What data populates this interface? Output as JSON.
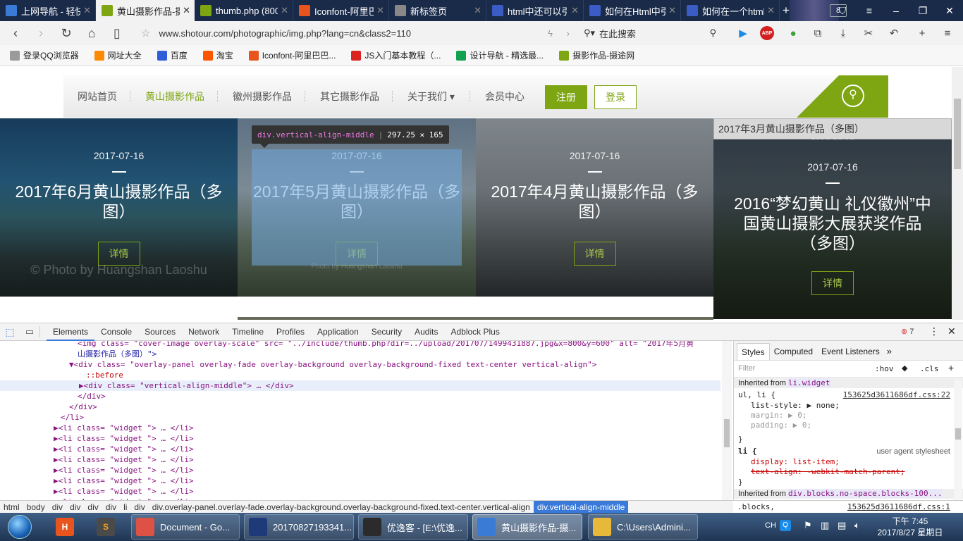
{
  "browser": {
    "tabs": [
      {
        "title": "上网导航 - 轻快上",
        "icon_color": "#3a7bd5",
        "icon": "e-icon"
      },
      {
        "title": "黄山摄影作品-摄",
        "icon_color": "#7ea512",
        "icon": "leaf-icon",
        "active": true
      },
      {
        "title": "thumb.php (800",
        "icon_color": "#7ea512",
        "icon": "leaf-icon"
      },
      {
        "title": "Iconfont-阿里巴巴",
        "icon_color": "#e8541e",
        "icon": "iconfont-icon"
      },
      {
        "title": "新标签页",
        "icon_color": "#888888",
        "icon": "grid-icon"
      },
      {
        "title": "html中还可以引h",
        "icon_color": "#3b5cc4",
        "icon": "csdn-icon"
      },
      {
        "title": "如何在Html中引入",
        "icon_color": "#3b5cc4",
        "icon": "csdn-icon"
      },
      {
        "title": "如何在一个html",
        "icon_color": "#3b5cc4",
        "icon": "csdn-icon"
      }
    ],
    "tab_count": "8",
    "url": "www.shotour.com/photographic/img.php?lang=cn&class2=110",
    "search_placeholder": "在此搜索",
    "bookmarks": [
      {
        "label": "登录QQ浏览器",
        "color": "#9a9a9a"
      },
      {
        "label": "网址大全",
        "color": "#ff8a00"
      },
      {
        "label": "百度",
        "color": "#2f5fd8"
      },
      {
        "label": "淘宝",
        "color": "#ff5500"
      },
      {
        "label": "Iconfont-阿里巴巴...",
        "color": "#e8541e"
      },
      {
        "label": "JS入门基本教程（...",
        "color": "#d8231f"
      },
      {
        "label": "设计导航 - 精选最...",
        "color": "#12a150"
      },
      {
        "label": "摄影作品-摄途网",
        "color": "#7ea512"
      }
    ]
  },
  "site": {
    "nav": [
      "网站首页",
      "黄山摄影作品",
      "徽州摄影作品",
      "其它摄影作品",
      "关于我们",
      "会员中心"
    ],
    "nav_active_index": 1,
    "register": "注册",
    "login": "登录",
    "accent": "#7ea512",
    "cards": [
      {
        "date": "2017-07-16",
        "title": "2017年6月黄山摄影作品（多图）",
        "button": "详情",
        "watermark": "© Photo by Huangshan Laoshu"
      },
      {
        "date": "2017-07-16",
        "title": "2017年5月黄山摄影作品（多图）",
        "button": "详情",
        "watermark": "Photo by Huangshan Laoshu"
      },
      {
        "date": "2017-07-16",
        "title": "2017年4月黄山摄影作品（多图）",
        "button": "详情"
      },
      {
        "date": "2017-07-16",
        "title": "2016“梦幻黄山 礼仪徽州”中国黄山摄影大展获奖作品（多图）",
        "button": "详情",
        "alt_text": "2017年3月黄山摄影作品（多图）",
        "hidden_date": "2017-07-16"
      }
    ]
  },
  "inspector_tooltip": {
    "selector": "div.vertical-align-middle",
    "size": "297.25 × 165"
  },
  "devtools": {
    "tabs": [
      "Elements",
      "Console",
      "Sources",
      "Network",
      "Timeline",
      "Profiles",
      "Application",
      "Security",
      "Audits",
      "Adblock Plus"
    ],
    "error_count": "7",
    "dom_lines": [
      "<img class= \"cover-image overlay-scale\" src= \"../include/thumb.php?dir=../upload/201707/1499431887.jpg&x=800&y=600\" alt= \"2017年5月黄",
      "山摄影作品（多图）\">",
      "▼<div class= \"overlay-panel overlay-fade overlay-background overlay-background-fixed text-center vertical-align\">",
      "::before",
      "▶<div class= \"vertical-align-middle\"> … </div>",
      "</div>",
      "</div>",
      "</li>",
      "▶<li class= \"widget \"> … </li>",
      "▶<li class= \"widget \"> … </li>",
      "▶<li class= \"widget \"> … </li>",
      "▶<li class= \"widget \"> … </li>",
      "▶<li class= \"widget \"> … </li>",
      "▶<li class= \"widget \"> … </li>",
      "▶<li class= \"widget \"> … </li>",
      "▶<li class= \"widget \"> … </li>"
    ],
    "styles_tabs": [
      "Styles",
      "Computed",
      "Event Listeners"
    ],
    "filter_placeholder": "Filter",
    "hov": ":hov",
    "cls": ".cls",
    "inherited_from_1": "Inherited from",
    "inherited_sel_1": "li.widget",
    "rule1_selector": "ul, li {",
    "rule1_source": "153625d3611686df.css:22",
    "rule1_props": [
      "list-style: ▶ none;",
      "margin: ▶ 0;",
      "padding: ▶ 0;"
    ],
    "rule2_selector": "li {",
    "rule2_source": "user agent stylesheet",
    "rule2_props": [
      "display: list-item;",
      "text-align: -webkit-match-parent;"
    ],
    "inherited_from_2": "Inherited from",
    "inherited_sel_2": "div.blocks.no-space.blocks-100...",
    "rule3_selector": ".blocks,",
    "rule3_source": "153625d3611686df.css:1",
    "crumbs": [
      "html",
      "body",
      "div",
      "div",
      "div",
      "div",
      "li",
      "div",
      "div.overlay-panel.overlay-fade.overlay-background.overlay-background-fixed.text-center.vertical-align",
      "div.vertical-align-middle"
    ]
  },
  "taskbar": {
    "items": [
      {
        "label": "Document - Go...",
        "icon_color": "#de5246",
        "icon": "chrome-icon"
      },
      {
        "label": "20170827193341...",
        "icon_color": "#1f3a78",
        "icon": "photoshop-icon"
      },
      {
        "label": "优逸客 - [E:\\优逸...",
        "icon_color": "#2b2b2b",
        "icon": "webstorm-icon"
      },
      {
        "label": "黄山摄影作品-摄...",
        "icon_color": "#3a7bd5",
        "icon": "qqbrowser-icon",
        "active": true
      },
      {
        "label": "C:\\Users\\Admini...",
        "icon_color": "#e6b93a",
        "icon": "folder-icon"
      }
    ],
    "ime": "CH",
    "time": "下午 7:45",
    "date": "2017/8/27 星期日"
  }
}
